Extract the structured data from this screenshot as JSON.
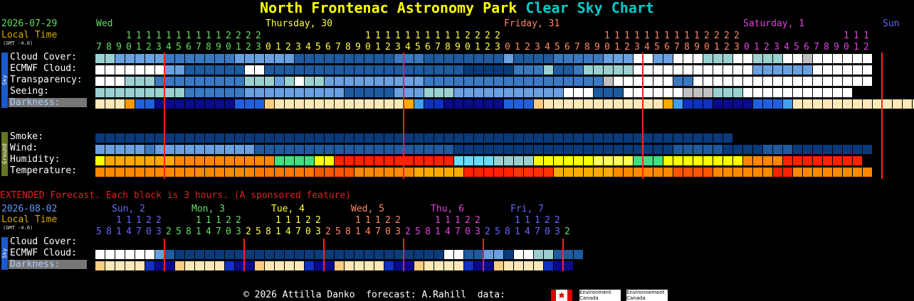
{
  "title": {
    "prefix": "North Frontenac Astronomy Park",
    "suffix": "Clear Sky Chart",
    "prefix_color": "#ffff00",
    "suffix_color": "#00cccc"
  },
  "main": {
    "date": "2026-07-29",
    "local_time": "Local Time",
    "gmt": "(GMT -4.0)",
    "days": [
      {
        "label": "Wed",
        "color": "#66dd66"
      },
      {
        "label": "Thursday, 30",
        "color": "#ffff44"
      },
      {
        "label": "Friday, 31",
        "color": "#ff8866"
      },
      {
        "label": "Saturday, 1",
        "color": "#dd44dd"
      },
      {
        "label": "Sun",
        "color": "#6666ff"
      }
    ],
    "hours_start": 7,
    "hours_count": 78,
    "rows_sky": [
      "Cloud Cover:",
      "ECMWF Cloud:",
      "Transparency:",
      "Seeing:",
      "Darkness:"
    ],
    "rows_ground": [
      "Smoke:",
      "Wind:",
      "Humidity:",
      "Temperature:"
    ],
    "sky_tab": "Sky",
    "ground_tab": "Ground"
  },
  "extended": {
    "banner": "EXTENDED Forecast. Each block is 3 hours. (A sponsored feature)",
    "date": "2026-08-02",
    "local_time": "Local Time",
    "gmt": "(GMT -4.0)",
    "days": [
      {
        "label": "Sun, 2",
        "color": "#6666ff"
      },
      {
        "label": "Mon, 3",
        "color": "#66dd66"
      },
      {
        "label": "Tue, 4",
        "color": "#ffff44"
      },
      {
        "label": "Wed, 5",
        "color": "#ff8866"
      },
      {
        "label": "Thu, 6",
        "color": "#dd44dd"
      },
      {
        "label": "Fri, 7",
        "color": "#6666ff"
      }
    ],
    "hours": "58147032581470325814703258147032581470325814703 2",
    "rows": [
      "Cloud Cover:",
      "ECMWF Cloud:",
      "Darkness:"
    ],
    "sky_tab": "Sky"
  },
  "footer": {
    "text": "© 2026 Attilla Danko  forecast: A.Rahill  data:",
    "agency": "Environment Canada",
    "agency_fr": "Environnement Canada"
  },
  "palette": {
    "dark_blue": "#0a3a7a",
    "mid_blue": "#1e5aa0",
    "blue": "#3a78c0",
    "light_blue": "#6aa0e0",
    "pale": "#9ad0d0",
    "white": "#ffffff",
    "grey": "#c0c0c0",
    "dark_night": "#0a0a8a",
    "night": "#1030c0",
    "twilight": "#2060e0",
    "dawn": "#40a0f0",
    "day": "#ffffff",
    "cream": "#ffe8b8",
    "orange": "#ff8800",
    "red": "#ff2200",
    "yellow": "#ffff00",
    "green": "#40e080",
    "red_line": "#ff2020"
  }
}
